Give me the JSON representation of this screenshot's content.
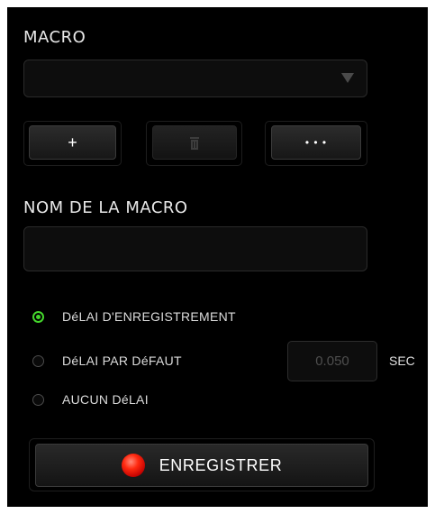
{
  "macro_section": {
    "title": "MACRO",
    "dropdown_value": "",
    "add_label": "+",
    "delete_icon": "trash-icon",
    "more_label": "• • •"
  },
  "name_section": {
    "title": "NOM DE LA MACRO",
    "value": "",
    "placeholder": ""
  },
  "delay_options": [
    {
      "label": "DéLAI D'ENREGISTREMENT",
      "selected": true
    },
    {
      "label": "DéLAI PAR DéFAUT",
      "selected": false
    },
    {
      "label": "AUCUN DéLAI",
      "selected": false
    }
  ],
  "default_delay": {
    "value": "0.050",
    "unit": "SEC"
  },
  "record_button": {
    "label": "ENREGISTRER"
  },
  "colors": {
    "accent": "#44d62c",
    "record": "#e01010",
    "background": "#000000"
  }
}
